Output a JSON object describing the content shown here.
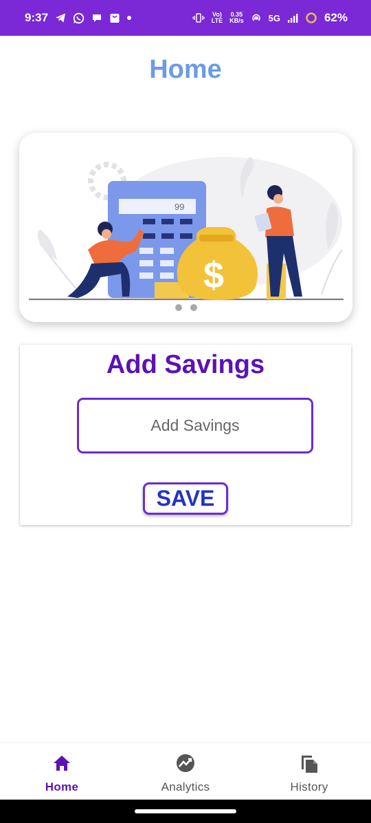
{
  "status_bar": {
    "time": "9:37",
    "network_top": "Vo)",
    "network_bottom": "LTE",
    "speed_top": "0.35",
    "speed_bottom": "KB/s",
    "network_type": "5G",
    "battery": "62%",
    "icons": [
      "telegram-icon",
      "whatsapp-icon",
      "chat-icon",
      "shopping-bag-icon",
      "dot-icon",
      "vibrate-icon",
      "hotspot-icon",
      "signal-icon",
      "battery-ring-icon"
    ]
  },
  "page": {
    "title": "Home"
  },
  "carousel": {
    "illustration": "savings-calculator-illustration",
    "calculator_display": "99",
    "dots": 2,
    "active_dot": 0
  },
  "savings": {
    "title": "Add Savings",
    "input_placeholder": "Add Savings",
    "input_value": "",
    "save_label": "SAVE"
  },
  "bottom_nav": {
    "items": [
      {
        "label": "Home",
        "icon": "home-icon",
        "active": true
      },
      {
        "label": "Analytics",
        "icon": "analytics-icon",
        "active": false
      },
      {
        "label": "History",
        "icon": "history-icon",
        "active": false
      }
    ]
  },
  "colors": {
    "status_bar": "#7b28d6",
    "title": "#6b9be6",
    "accent_purple": "#5b12b8",
    "border_purple": "#6a2bd6",
    "save_text": "#2233c8"
  }
}
